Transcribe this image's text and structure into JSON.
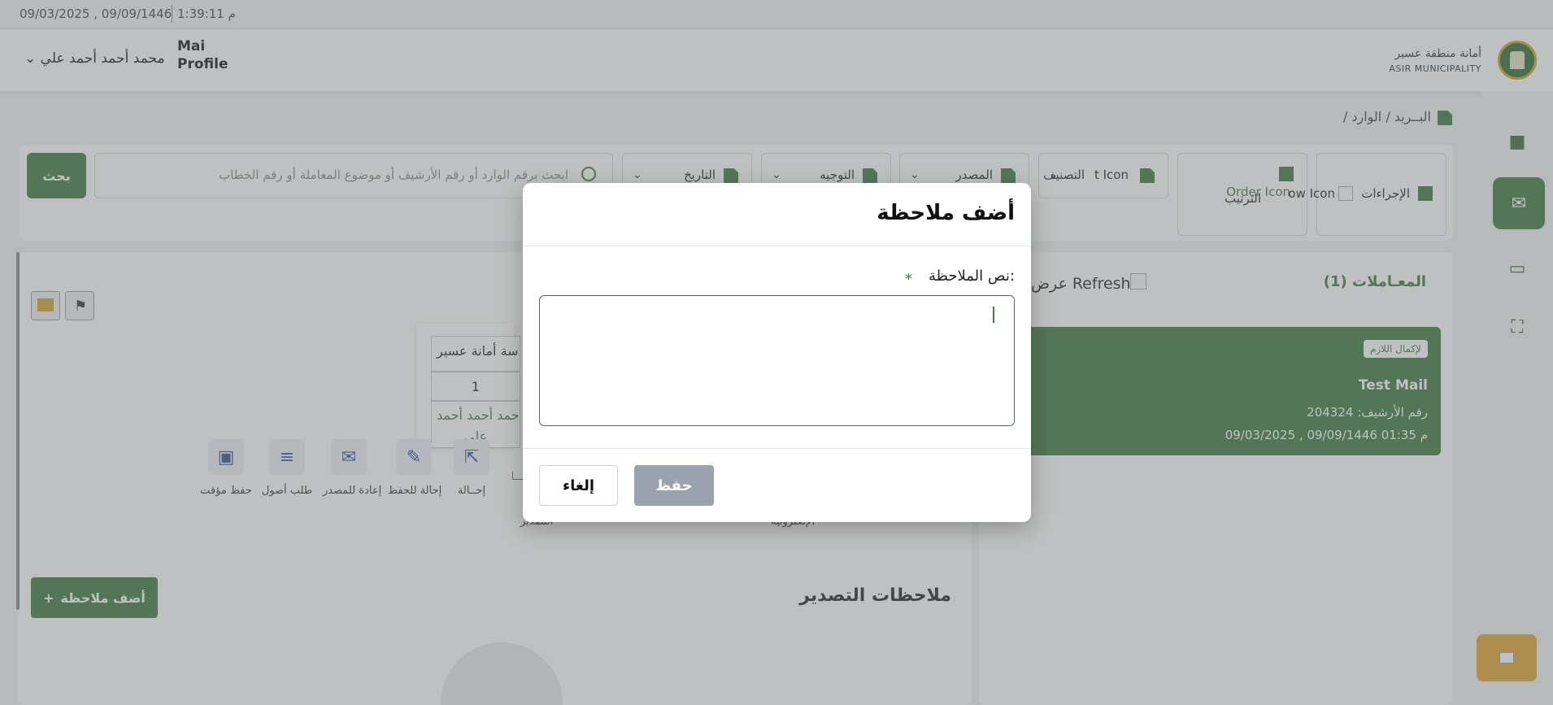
{
  "topbar": {
    "datetime": "09/03/2025 , 09/09/1446",
    "time": "1:39:11 م"
  },
  "header": {
    "user_name": "محمد أحمد أحمد علي",
    "user_menu_icon": "chevron-down-icon",
    "profile_line1": "Mai",
    "profile_line2": "Profile",
    "logo_line1": "أمانة منطقة عسير",
    "logo_line2": "ASIR MUNICIPALITY"
  },
  "breadcrumb": {
    "text": "/  البــريد  /  الوارد"
  },
  "filters": {
    "search_button": "بحث",
    "search_placeholder": "ابحث برقم الوارد أو رقم الأرشيف أو موضوع المعاملة أو رقم الخطاب",
    "date_label": "التاريخ",
    "direction_label": "التوجيه",
    "source_label": "المصدر",
    "classification_label": "التصنيف",
    "classification_icon_alt": "t Icon",
    "order_label": "الترتيب",
    "order_icon_alt": "Order Icon",
    "actions_label": "الإجراءات",
    "arrow_icon_alt": "ow Icon"
  },
  "left_panel": {
    "table": {
      "header": "سة أمانة عسير",
      "value": "1",
      "name_line1": "حمد أحمد أحمد",
      "name_line2": "علي"
    },
    "actions": [
      {
        "label": "حفظ مؤقت",
        "icon": "save-icon"
      },
      {
        "label": "طلب أصول",
        "icon": "add-document-icon"
      },
      {
        "label": "إعادة للمصدر",
        "icon": "return-mail-icon"
      },
      {
        "label": "إحالة للحفظ",
        "icon": "archive-transfer-icon"
      },
      {
        "label": "إحــالة",
        "icon": "forward-icon"
      }
    ],
    "partial_label_1": "التصدير",
    "partial_label_2": "الإلكترونية",
    "add_note_button": "أضف ملاحظة",
    "notes_title": "ملاحظات التصدير"
  },
  "right_panel": {
    "title": "المعـاملات (1)",
    "refresh_text": "عرض  Refresh",
    "card": {
      "badge": "لإكمال اللازم",
      "title": "Test Mail",
      "archive": "رقم الأرشيف: 204324",
      "date": "09/03/2025 , 09/09/1446   01:35 م"
    }
  },
  "modal": {
    "title": "أضف ملاحظة",
    "field_label": "نص الملاحظة:",
    "required_mark": "*",
    "textarea_value": "",
    "save_button": "حفظ",
    "cancel_button": "إلغاء"
  },
  "colors": {
    "primary": "#3d7a3d",
    "disabled": "#9aa3ad",
    "accent": "#e0a32e"
  }
}
